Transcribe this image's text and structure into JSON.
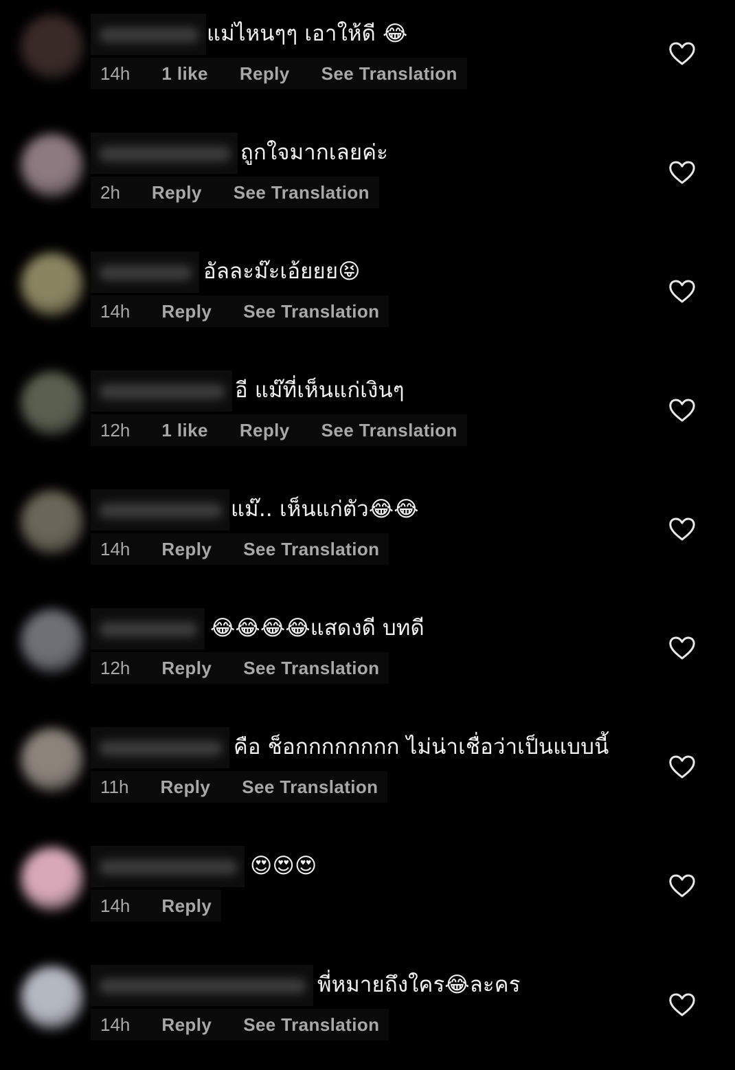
{
  "comments": [
    {
      "text": "แม่ไหนๆๆ เอาให้ดี 😂",
      "time": "14h",
      "likes": "1 like",
      "reply": "Reply",
      "translate": "See Translation",
      "avatar_color": "#3a2a26"
    },
    {
      "text": "ถูกใจมากเลยค่ะ",
      "time": "2h",
      "likes": "",
      "reply": "Reply",
      "translate": "See Translation",
      "avatar_color": "#8c7a80"
    },
    {
      "text": "อัลละม๊ะเอ้ยยย😝",
      "time": "14h",
      "likes": "",
      "reply": "Reply",
      "translate": "See Translation",
      "avatar_color": "#8a8460"
    },
    {
      "text": "อี แม๊ที่เห็นแก่เงินๆ",
      "time": "12h",
      "likes": "1 like",
      "reply": "Reply",
      "translate": "See Translation",
      "avatar_color": "#5a6050"
    },
    {
      "text": "แม๊.. เห็นแก่ตัว😂😂",
      "time": "14h",
      "likes": "",
      "reply": "Reply",
      "translate": "See Translation",
      "avatar_color": "#6a6658"
    },
    {
      "text": "😂😂😂😂แสดงดี บทดี",
      "time": "12h",
      "likes": "",
      "reply": "Reply",
      "translate": "See Translation",
      "avatar_color": "#6e7076"
    },
    {
      "text": "คือ ช็อกกกกกกกก ไม่น่าเชื่อว่าเป็นแบบนี้",
      "time": "11h",
      "likes": "",
      "reply": "Reply",
      "translate": "See Translation",
      "avatar_color": "#8a847a"
    },
    {
      "text": "😍😍😍",
      "time": "14h",
      "likes": "",
      "reply": "Reply",
      "translate": "",
      "avatar_color": "#d8a8b8"
    },
    {
      "text": "พี่หมายถึงใคร😂ละคร",
      "time": "14h",
      "likes": "",
      "reply": "Reply",
      "translate": "See Translation",
      "avatar_color": "#b4b8c0"
    }
  ],
  "icons": {
    "like": "heart-outline-icon"
  },
  "colors": {
    "background": "#000000",
    "text": "#f2f2f2",
    "meta": "#a8a8a8",
    "heart": "#e8e8e8"
  }
}
